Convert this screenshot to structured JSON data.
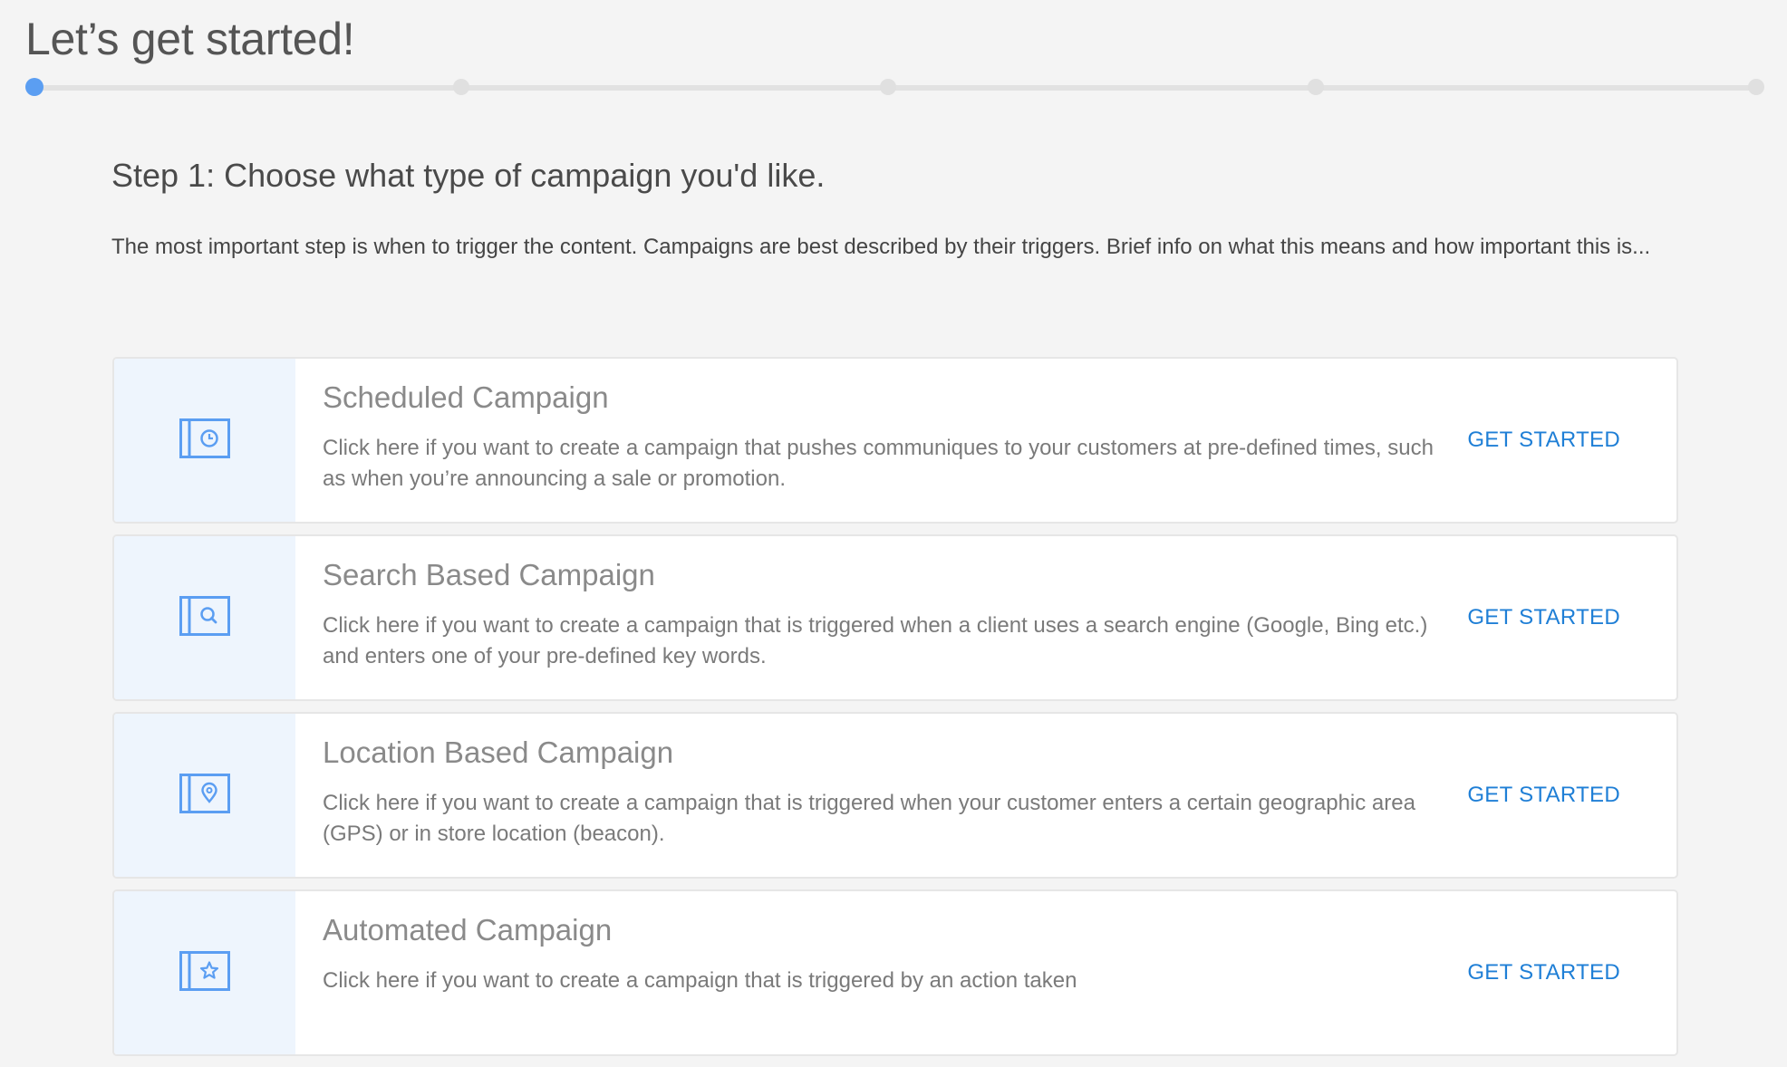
{
  "page": {
    "title": "Let’s get started!"
  },
  "progress": {
    "total_steps": 5,
    "current_step": 1
  },
  "step": {
    "heading": "Step 1: Choose what type of campaign you'd like.",
    "intro": "The most important step is when to trigger the content. Campaigns are best described by their triggers. Brief info on what this means and how important this is..."
  },
  "campaigns": [
    {
      "title": "Scheduled Campaign",
      "description": "Click here if you want to create a campaign that pushes communiques to your customers at pre-defined times, such as when you’re announcing a sale or promotion.",
      "cta": "GET STARTED",
      "icon": "clock-icon"
    },
    {
      "title": "Search Based Campaign",
      "description": "Click here if you want to create a campaign that is triggered when a client uses a search engine (Google, Bing etc.) and enters one of your pre-defined key words.",
      "cta": "GET STARTED",
      "icon": "search-icon"
    },
    {
      "title": "Location Based Campaign",
      "description": "Click here if you want to create a campaign that is triggered when your customer enters a certain geographic area (GPS) or in store location (beacon).",
      "cta": "GET STARTED",
      "icon": "location-pin-icon"
    },
    {
      "title": "Automated Campaign",
      "description": "Click here if you want to create a campaign that is triggered by an action taken",
      "cta": "GET STARTED",
      "icon": "star-icon"
    }
  ],
  "colors": {
    "accent": "#1f7fd6",
    "progress_active": "#5b9ef2",
    "icon_panel_bg": "#eef5fd",
    "icon_stroke": "#5b9ef2",
    "page_bg": "#f4f4f4"
  }
}
